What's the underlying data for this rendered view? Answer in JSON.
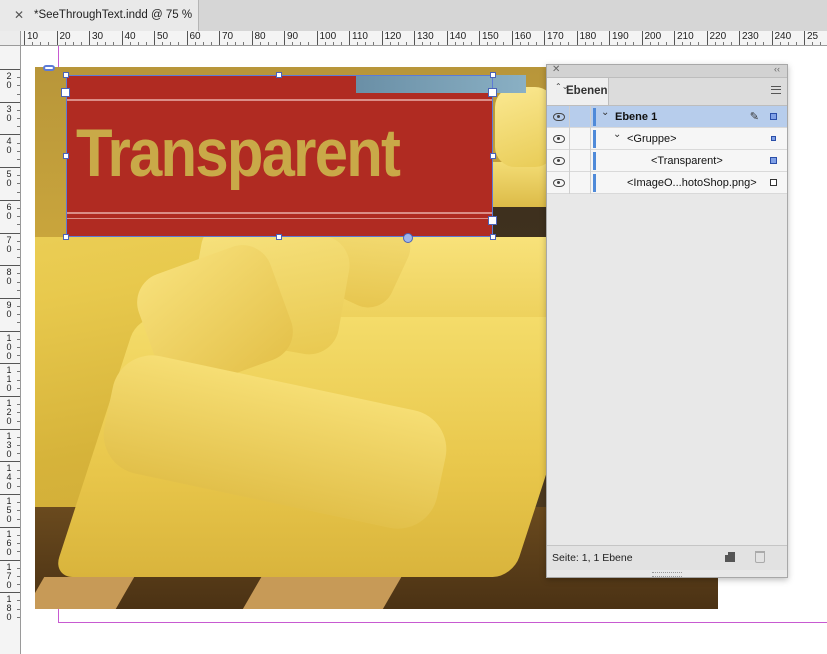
{
  "document_tab": {
    "close_glyph": "✕",
    "title": "*SeeThroughText.indd @ 75 %"
  },
  "ruler_h": {
    "labels": [
      "10",
      "20",
      "30",
      "40",
      "50",
      "60",
      "70",
      "80",
      "90",
      "100",
      "110",
      "120",
      "130",
      "140",
      "150",
      "160",
      "170",
      "180",
      "190",
      "200",
      "210",
      "220",
      "230",
      "240",
      "25"
    ]
  },
  "ruler_v": {
    "labels": [
      "2",
      "3",
      "4",
      "5",
      "6",
      "7",
      "8",
      "9",
      "10",
      "11",
      "12",
      "13",
      "14",
      "15",
      "16",
      "17",
      "18"
    ]
  },
  "canvas": {
    "text_frame": {
      "text": "Transparent",
      "fill_color": "#b02b22",
      "text_color": "#c9a948"
    },
    "selection_color": "#4a62b8",
    "guide_color": "#c75ad1"
  },
  "layers_panel": {
    "close_glyph": "✕",
    "collapse_glyph": "‹‹",
    "tab_label": "Ebenen",
    "tab_arrows": "⌃⌄",
    "rows": [
      {
        "label": "Ebene 1",
        "indent": 0,
        "expanded": true,
        "selected": true,
        "bold": true,
        "pen": "✎",
        "swatch": "filled"
      },
      {
        "label": "<Gruppe>",
        "indent": 1,
        "expanded": true,
        "selected": false,
        "bold": false,
        "pen": "",
        "swatch": "small"
      },
      {
        "label": "<Transparent>",
        "indent": 2,
        "expanded": false,
        "selected": false,
        "bold": false,
        "pen": "",
        "swatch": "filled"
      },
      {
        "label": "<ImageO...hotoShop.png>",
        "indent": 1,
        "expanded": false,
        "selected": false,
        "bold": false,
        "pen": "",
        "swatch": "hollow"
      }
    ],
    "footer_text": "Seite: 1, 1 Ebene",
    "layer_color": "#4f8ad9"
  }
}
